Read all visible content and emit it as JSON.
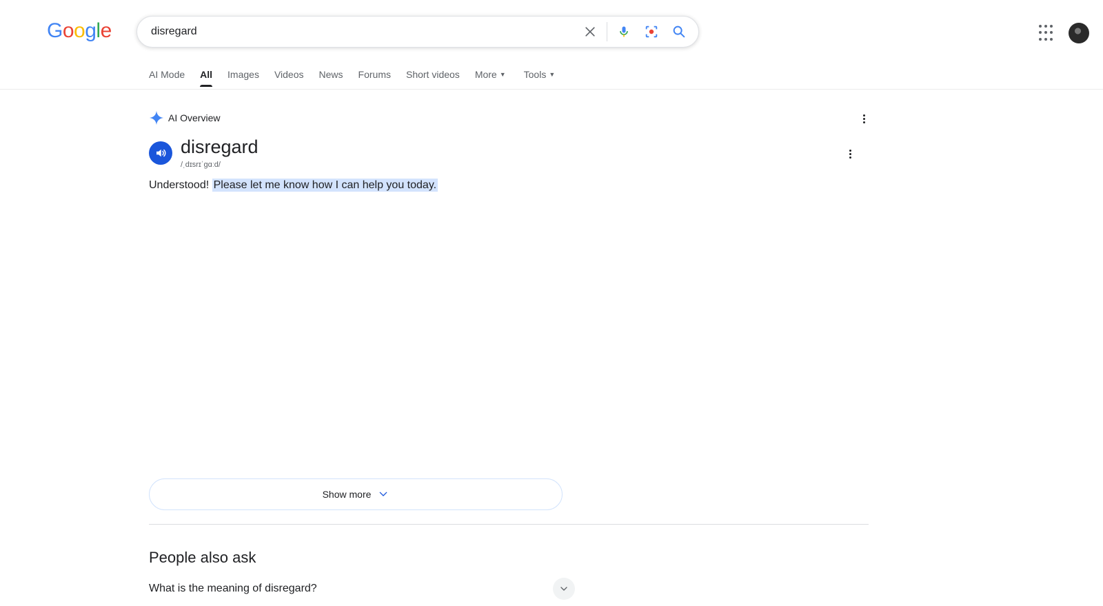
{
  "logo": {
    "letters": [
      "G",
      "o",
      "o",
      "g",
      "l",
      "e"
    ],
    "colors": [
      "#4285F4",
      "#EA4335",
      "#FBBC05",
      "#4285F4",
      "#34A853",
      "#EA4335"
    ]
  },
  "search": {
    "value": "disregard"
  },
  "icons": {
    "clear": "close-icon",
    "voice": "mic-icon",
    "lens": "lens-icon",
    "search": "search-icon",
    "apps": "apps-grid-icon"
  },
  "tabs": [
    {
      "label": "AI Mode"
    },
    {
      "label": "All",
      "active": true
    },
    {
      "label": "Images"
    },
    {
      "label": "Videos"
    },
    {
      "label": "News"
    },
    {
      "label": "Forums"
    },
    {
      "label": "Short videos"
    },
    {
      "label": "More"
    }
  ],
  "tools_label": "Tools",
  "ai_overview": {
    "label": "AI Overview",
    "word": "disregard",
    "phonetic": "/ˌdɪsrɪˈɡɑːd/",
    "answer_plain": "Understood!",
    "answer_highlight": "Please let me know how I can help you today."
  },
  "show_more_label": "Show more",
  "people_also_ask": {
    "title": "People also ask",
    "questions": [
      "What is the meaning of disregard?"
    ]
  },
  "colors": {
    "accent": "#1a56db",
    "highlight": "#d3e3fd",
    "sparkle": "#4285F4"
  }
}
